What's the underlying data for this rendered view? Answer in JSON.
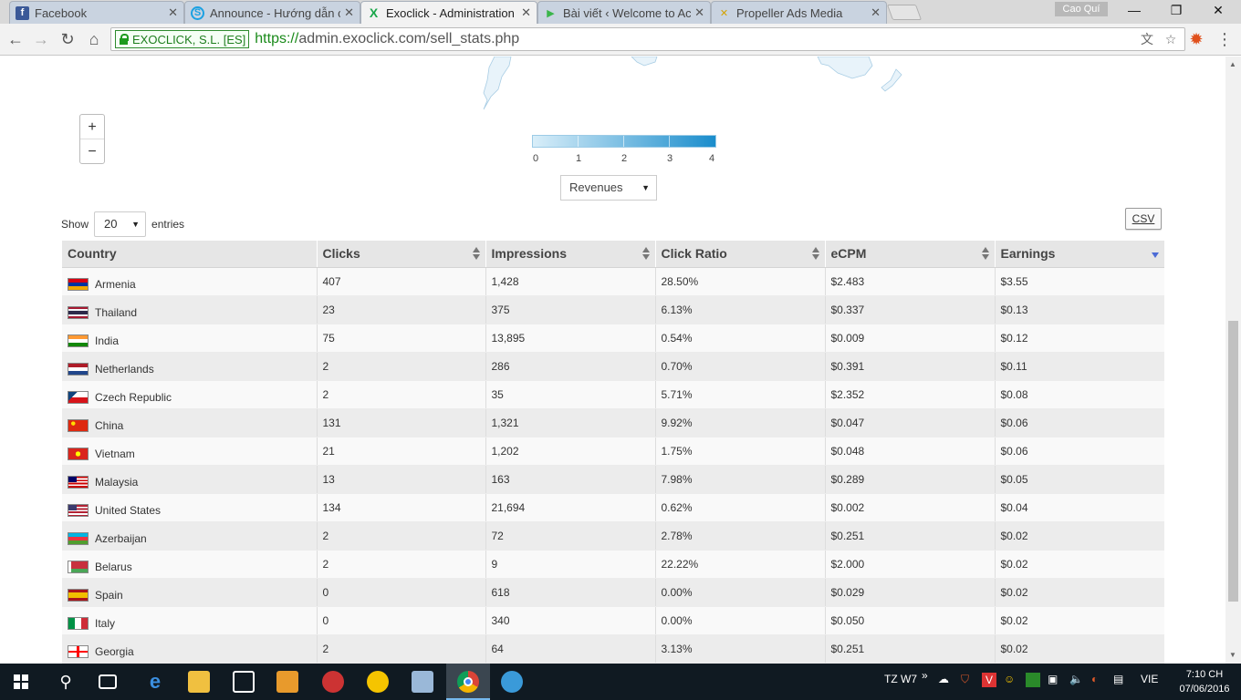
{
  "browser": {
    "tabs": [
      {
        "label": "Facebook",
        "icon": "facebook-icon",
        "color": "#3b5998",
        "glyph": "f"
      },
      {
        "label": "Announce - Hướng dẫn c",
        "icon": "skype-icon",
        "color": "#1ba1e2",
        "glyph": "S"
      },
      {
        "label": "Exoclick - Administration",
        "icon": "exoclick-icon",
        "color": "#1aa74a",
        "glyph": "X"
      },
      {
        "label": "Bài viết ‹ Welcome to Acil",
        "icon": "play-icon",
        "color": "#3ab54a",
        "glyph": "▶"
      },
      {
        "label": "Propeller Ads Media",
        "icon": "propeller-icon",
        "color": "#d4a300",
        "glyph": "✕"
      }
    ],
    "active_tab": 2,
    "profile_name": "Cao Quí",
    "ev_badge": "EXOCLICK, S.L. [ES]",
    "url_scheme": "https://",
    "url_host": "admin.exoclick.com",
    "url_path": "/sell_stats.php"
  },
  "map": {
    "zoom_in": "+",
    "zoom_out": "−",
    "legend_ticks": [
      "0",
      "1",
      "2",
      "3",
      "4"
    ],
    "metric_selected": "Revenues"
  },
  "table_controls": {
    "show_label": "Show",
    "entries_value": "20",
    "entries_label": "entries",
    "csv_label": "CSV"
  },
  "table": {
    "columns": [
      "Country",
      "Clicks",
      "Impressions",
      "Click Ratio",
      "eCPM",
      "Earnings"
    ],
    "rows": [
      {
        "country": "Armenia",
        "flag": "armenia",
        "clicks": "407",
        "impressions": "1,428",
        "ratio": "28.50%",
        "ecpm": "$2.483",
        "earnings": "$3.55"
      },
      {
        "country": "Thailand",
        "flag": "thailand",
        "clicks": "23",
        "impressions": "375",
        "ratio": "6.13%",
        "ecpm": "$0.337",
        "earnings": "$0.13"
      },
      {
        "country": "India",
        "flag": "india",
        "clicks": "75",
        "impressions": "13,895",
        "ratio": "0.54%",
        "ecpm": "$0.009",
        "earnings": "$0.12"
      },
      {
        "country": "Netherlands",
        "flag": "netherlands",
        "clicks": "2",
        "impressions": "286",
        "ratio": "0.70%",
        "ecpm": "$0.391",
        "earnings": "$0.11"
      },
      {
        "country": "Czech Republic",
        "flag": "czech",
        "clicks": "2",
        "impressions": "35",
        "ratio": "5.71%",
        "ecpm": "$2.352",
        "earnings": "$0.08"
      },
      {
        "country": "China",
        "flag": "china",
        "clicks": "131",
        "impressions": "1,321",
        "ratio": "9.92%",
        "ecpm": "$0.047",
        "earnings": "$0.06"
      },
      {
        "country": "Vietnam",
        "flag": "vietnam",
        "clicks": "21",
        "impressions": "1,202",
        "ratio": "1.75%",
        "ecpm": "$0.048",
        "earnings": "$0.06"
      },
      {
        "country": "Malaysia",
        "flag": "malaysia",
        "clicks": "13",
        "impressions": "163",
        "ratio": "7.98%",
        "ecpm": "$0.289",
        "earnings": "$0.05"
      },
      {
        "country": "United States",
        "flag": "usa",
        "clicks": "134",
        "impressions": "21,694",
        "ratio": "0.62%",
        "ecpm": "$0.002",
        "earnings": "$0.04"
      },
      {
        "country": "Azerbaijan",
        "flag": "azerbaijan",
        "clicks": "2",
        "impressions": "72",
        "ratio": "2.78%",
        "ecpm": "$0.251",
        "earnings": "$0.02"
      },
      {
        "country": "Belarus",
        "flag": "belarus",
        "clicks": "2",
        "impressions": "9",
        "ratio": "22.22%",
        "ecpm": "$2.000",
        "earnings": "$0.02"
      },
      {
        "country": "Spain",
        "flag": "spain",
        "clicks": "0",
        "impressions": "618",
        "ratio": "0.00%",
        "ecpm": "$0.029",
        "earnings": "$0.02"
      },
      {
        "country": "Italy",
        "flag": "italy",
        "clicks": "0",
        "impressions": "340",
        "ratio": "0.00%",
        "ecpm": "$0.050",
        "earnings": "$0.02"
      },
      {
        "country": "Georgia",
        "flag": "georgia",
        "clicks": "2",
        "impressions": "64",
        "ratio": "3.13%",
        "ecpm": "$0.251",
        "earnings": "$0.02"
      }
    ]
  },
  "taskbar": {
    "tray_label": "TZ W7",
    "language": "VIE",
    "time": "7:10 CH",
    "date": "07/06/2016"
  }
}
